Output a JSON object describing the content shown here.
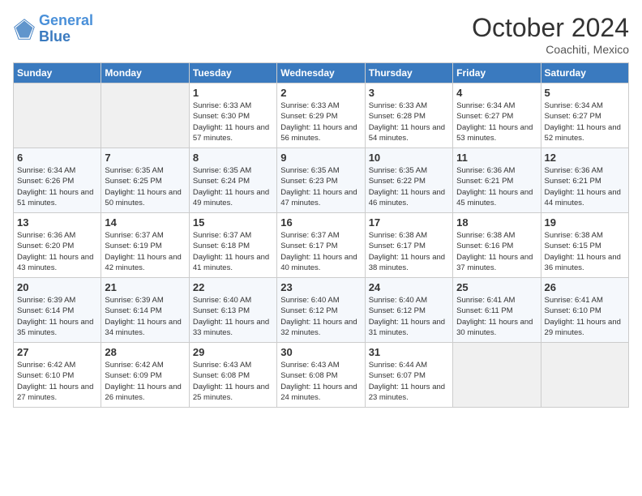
{
  "logo": {
    "line1": "General",
    "line2": "Blue"
  },
  "header": {
    "month": "October 2024",
    "location": "Coachiti, Mexico"
  },
  "weekdays": [
    "Sunday",
    "Monday",
    "Tuesday",
    "Wednesday",
    "Thursday",
    "Friday",
    "Saturday"
  ],
  "weeks": [
    [
      {
        "day": "",
        "detail": ""
      },
      {
        "day": "",
        "detail": ""
      },
      {
        "day": "1",
        "detail": "Sunrise: 6:33 AM\nSunset: 6:30 PM\nDaylight: 11 hours and 57 minutes."
      },
      {
        "day": "2",
        "detail": "Sunrise: 6:33 AM\nSunset: 6:29 PM\nDaylight: 11 hours and 56 minutes."
      },
      {
        "day": "3",
        "detail": "Sunrise: 6:33 AM\nSunset: 6:28 PM\nDaylight: 11 hours and 54 minutes."
      },
      {
        "day": "4",
        "detail": "Sunrise: 6:34 AM\nSunset: 6:27 PM\nDaylight: 11 hours and 53 minutes."
      },
      {
        "day": "5",
        "detail": "Sunrise: 6:34 AM\nSunset: 6:27 PM\nDaylight: 11 hours and 52 minutes."
      }
    ],
    [
      {
        "day": "6",
        "detail": "Sunrise: 6:34 AM\nSunset: 6:26 PM\nDaylight: 11 hours and 51 minutes."
      },
      {
        "day": "7",
        "detail": "Sunrise: 6:35 AM\nSunset: 6:25 PM\nDaylight: 11 hours and 50 minutes."
      },
      {
        "day": "8",
        "detail": "Sunrise: 6:35 AM\nSunset: 6:24 PM\nDaylight: 11 hours and 49 minutes."
      },
      {
        "day": "9",
        "detail": "Sunrise: 6:35 AM\nSunset: 6:23 PM\nDaylight: 11 hours and 47 minutes."
      },
      {
        "day": "10",
        "detail": "Sunrise: 6:35 AM\nSunset: 6:22 PM\nDaylight: 11 hours and 46 minutes."
      },
      {
        "day": "11",
        "detail": "Sunrise: 6:36 AM\nSunset: 6:21 PM\nDaylight: 11 hours and 45 minutes."
      },
      {
        "day": "12",
        "detail": "Sunrise: 6:36 AM\nSunset: 6:21 PM\nDaylight: 11 hours and 44 minutes."
      }
    ],
    [
      {
        "day": "13",
        "detail": "Sunrise: 6:36 AM\nSunset: 6:20 PM\nDaylight: 11 hours and 43 minutes."
      },
      {
        "day": "14",
        "detail": "Sunrise: 6:37 AM\nSunset: 6:19 PM\nDaylight: 11 hours and 42 minutes."
      },
      {
        "day": "15",
        "detail": "Sunrise: 6:37 AM\nSunset: 6:18 PM\nDaylight: 11 hours and 41 minutes."
      },
      {
        "day": "16",
        "detail": "Sunrise: 6:37 AM\nSunset: 6:17 PM\nDaylight: 11 hours and 40 minutes."
      },
      {
        "day": "17",
        "detail": "Sunrise: 6:38 AM\nSunset: 6:17 PM\nDaylight: 11 hours and 38 minutes."
      },
      {
        "day": "18",
        "detail": "Sunrise: 6:38 AM\nSunset: 6:16 PM\nDaylight: 11 hours and 37 minutes."
      },
      {
        "day": "19",
        "detail": "Sunrise: 6:38 AM\nSunset: 6:15 PM\nDaylight: 11 hours and 36 minutes."
      }
    ],
    [
      {
        "day": "20",
        "detail": "Sunrise: 6:39 AM\nSunset: 6:14 PM\nDaylight: 11 hours and 35 minutes."
      },
      {
        "day": "21",
        "detail": "Sunrise: 6:39 AM\nSunset: 6:14 PM\nDaylight: 11 hours and 34 minutes."
      },
      {
        "day": "22",
        "detail": "Sunrise: 6:40 AM\nSunset: 6:13 PM\nDaylight: 11 hours and 33 minutes."
      },
      {
        "day": "23",
        "detail": "Sunrise: 6:40 AM\nSunset: 6:12 PM\nDaylight: 11 hours and 32 minutes."
      },
      {
        "day": "24",
        "detail": "Sunrise: 6:40 AM\nSunset: 6:12 PM\nDaylight: 11 hours and 31 minutes."
      },
      {
        "day": "25",
        "detail": "Sunrise: 6:41 AM\nSunset: 6:11 PM\nDaylight: 11 hours and 30 minutes."
      },
      {
        "day": "26",
        "detail": "Sunrise: 6:41 AM\nSunset: 6:10 PM\nDaylight: 11 hours and 29 minutes."
      }
    ],
    [
      {
        "day": "27",
        "detail": "Sunrise: 6:42 AM\nSunset: 6:10 PM\nDaylight: 11 hours and 27 minutes."
      },
      {
        "day": "28",
        "detail": "Sunrise: 6:42 AM\nSunset: 6:09 PM\nDaylight: 11 hours and 26 minutes."
      },
      {
        "day": "29",
        "detail": "Sunrise: 6:43 AM\nSunset: 6:08 PM\nDaylight: 11 hours and 25 minutes."
      },
      {
        "day": "30",
        "detail": "Sunrise: 6:43 AM\nSunset: 6:08 PM\nDaylight: 11 hours and 24 minutes."
      },
      {
        "day": "31",
        "detail": "Sunrise: 6:44 AM\nSunset: 6:07 PM\nDaylight: 11 hours and 23 minutes."
      },
      {
        "day": "",
        "detail": ""
      },
      {
        "day": "",
        "detail": ""
      }
    ]
  ]
}
